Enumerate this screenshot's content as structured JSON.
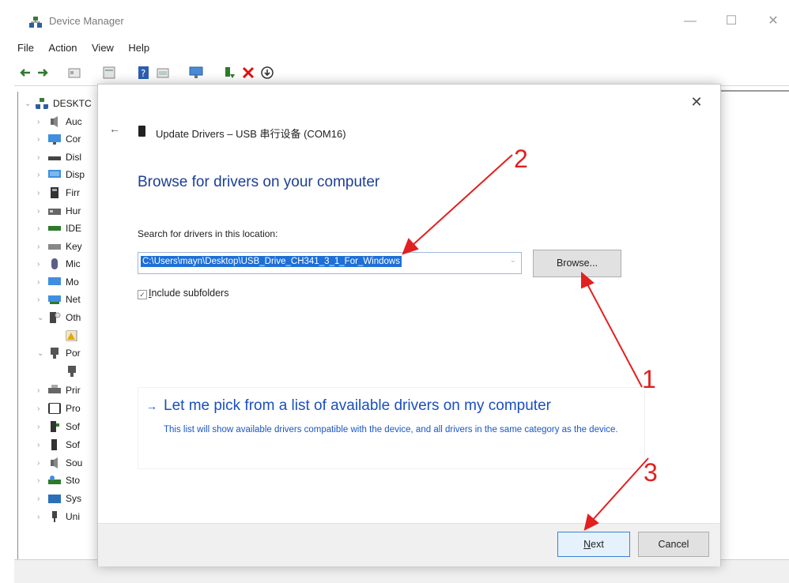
{
  "window": {
    "title": "Device Manager",
    "menu": [
      "File",
      "Action",
      "View",
      "Help"
    ],
    "controls": [
      "—",
      "☐",
      "✕"
    ]
  },
  "tree": {
    "root": "DESKTC",
    "items": [
      "Auc",
      "Cor",
      "Disl",
      "Disp",
      "Firr",
      "Hur",
      "IDE",
      "Key",
      "Mic",
      "Mo",
      "Net",
      "Oth",
      "",
      "Por",
      "",
      "Prir",
      "Pro",
      "Sof",
      "Sof",
      "Sou",
      "Sto",
      "Sys",
      "Uni"
    ]
  },
  "dialog": {
    "title": "Update Drivers – USB 串行设备 (COM16)",
    "heading": "Browse for drivers on your computer",
    "location_label": "Search for drivers in this location:",
    "path_value": "C:\\Users\\mayn\\Desktop\\USB_Drive_CH341_3_1_For_Windows",
    "browse_label": "Browse...",
    "include_subfolders_label": "Include subfolders",
    "include_subfolders_checked": true,
    "pick_title": "Let me pick from a list of available drivers on my computer",
    "pick_desc": "This list will show available drivers compatible with the device, and all drivers in the same category as the device.",
    "next_label": "Next",
    "cancel_label": "Cancel"
  },
  "annotations": {
    "step1": "1",
    "step2": "2",
    "step3": "3",
    "color": "#e22020"
  },
  "colors": {
    "heading": "#1c3f94",
    "link": "#1a4fc0",
    "selection": "#1e6fd6"
  }
}
